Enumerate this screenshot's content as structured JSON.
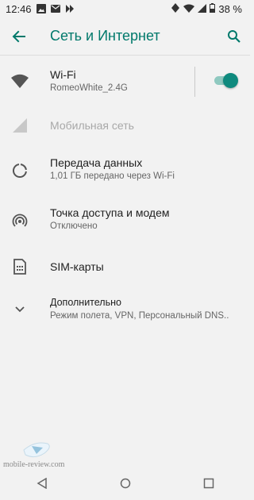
{
  "status_bar": {
    "time": "12:46",
    "battery": "38 %",
    "left_icons": [
      "gallery-icon",
      "mail-icon",
      "fast-forward-icon"
    ],
    "right_icons": [
      "vibrate-icon",
      "wifi-icon",
      "signal-icon",
      "battery-icon"
    ]
  },
  "app_bar": {
    "title": "Сеть и Интернет",
    "accent_color": "#00796b"
  },
  "items": [
    {
      "title": "Wi-Fi",
      "subtitle": "RomeoWhite_2.4G",
      "icon": "wifi-icon",
      "toggle_on": true
    },
    {
      "title": "Мобильная сеть",
      "icon": "signal-icon",
      "disabled": true
    },
    {
      "title": "Передача данных",
      "subtitle": "1,01 ГБ передано через Wi-Fi",
      "icon": "data-usage-icon"
    },
    {
      "title": "Точка доступа и модем",
      "subtitle": "Отключено",
      "icon": "hotspot-icon"
    },
    {
      "title": "SIM-карты",
      "icon": "sim-card-icon"
    },
    {
      "title": "Дополнительно",
      "subtitle": "Режим полета, VPN, Персональный DNS..",
      "icon": "chevron-down-icon"
    }
  ],
  "watermark": "mobile-review.com",
  "nav_bar": [
    "back-icon",
    "home-icon",
    "recents-icon"
  ]
}
